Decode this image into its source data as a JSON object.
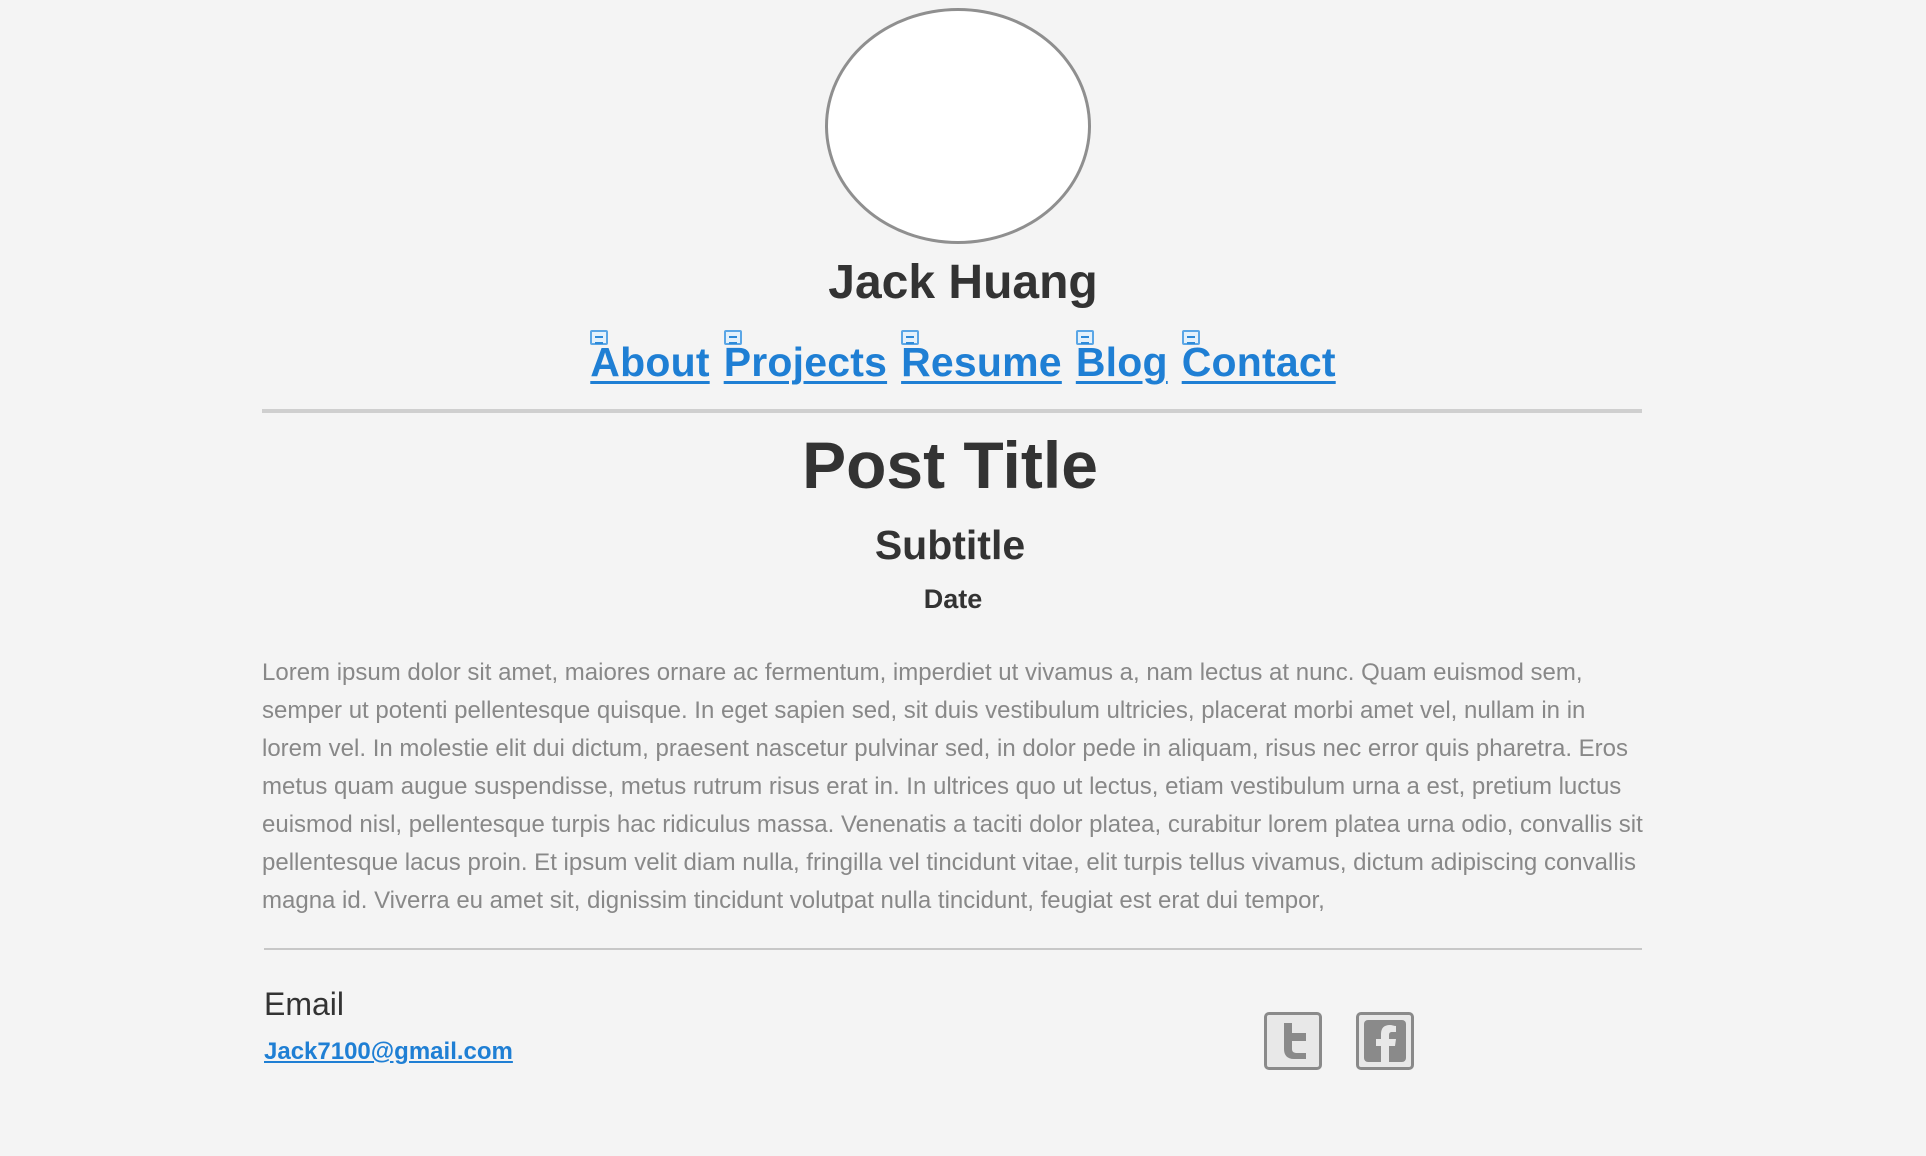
{
  "profile": {
    "name": "Jack Huang"
  },
  "nav": {
    "items": [
      {
        "label": "About"
      },
      {
        "label": "Projects"
      },
      {
        "label": "Resume"
      },
      {
        "label": "Blog"
      },
      {
        "label": "Contact"
      }
    ]
  },
  "post": {
    "title": "Post Title",
    "subtitle": "Subtitle",
    "date": "Date",
    "body": "Lorem ipsum dolor sit amet, maiores ornare ac fermentum, imperdiet ut vivamus a, nam lectus at nunc. Quam euismod sem, semper ut potenti pellentesque quisque. In eget sapien sed, sit duis vestibulum ultricies, placerat morbi amet vel, nullam in in lorem vel. In molestie elit dui dictum, praesent nascetur pulvinar sed, in dolor pede in aliquam, risus nec error quis pharetra. Eros metus quam augue suspendisse, metus rutrum risus erat in.  In ultrices quo ut lectus, etiam vestibulum urna a est, pretium luctus euismod nisl, pellentesque turpis hac ridiculus massa. Venenatis a taciti dolor platea, curabitur lorem platea urna odio, convallis sit pellentesque lacus proin. Et ipsum velit diam nulla, fringilla vel tincidunt vitae, elit turpis tellus vivamus, dictum adipiscing convallis magna id. Viverra eu amet sit, dignissim tincidunt volutpat nulla tincidunt, feugiat est erat dui tempor,"
  },
  "footer": {
    "email_label": "Email",
    "email_address": "Jack7100@gmail.com",
    "social": [
      {
        "icon": "twitter-icon"
      },
      {
        "icon": "facebook-icon"
      }
    ]
  },
  "colors": {
    "background": "#f4f4f4",
    "text": "#333333",
    "link": "#1f7fd4",
    "body_text": "#888888",
    "rule": "#cfcfcf"
  }
}
